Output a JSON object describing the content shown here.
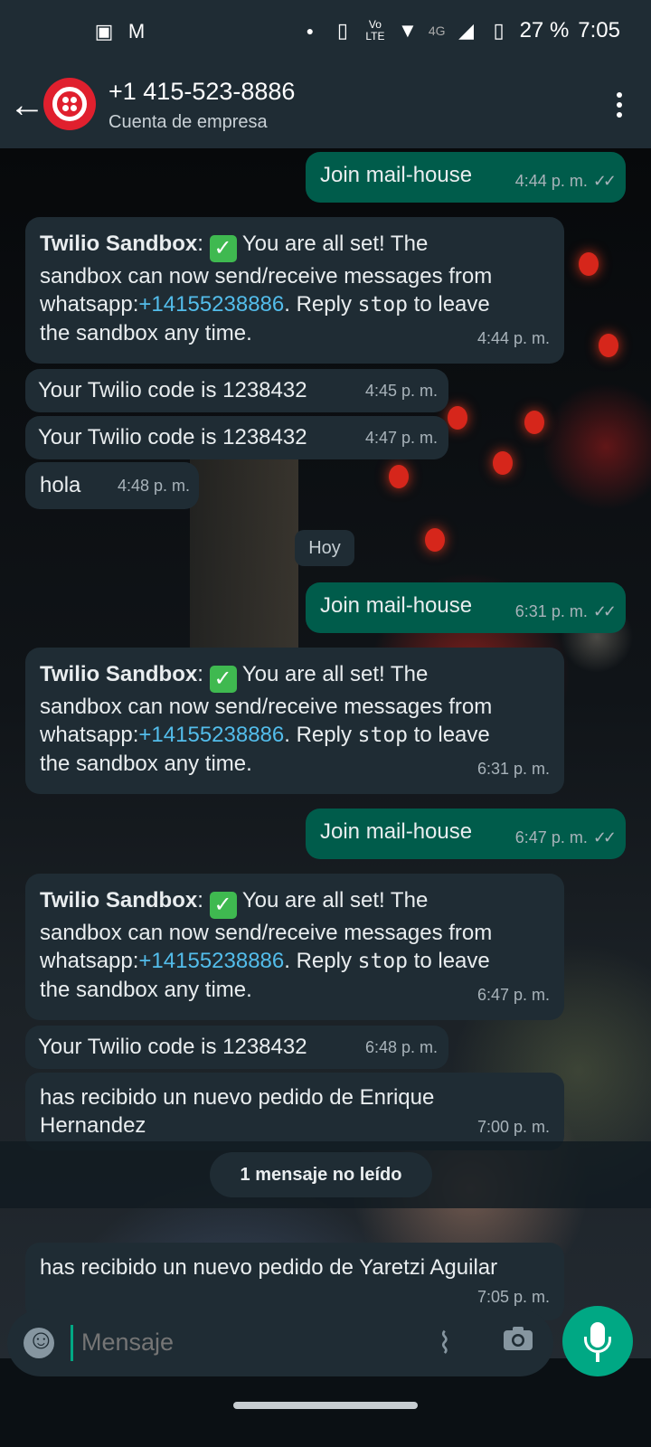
{
  "status_bar": {
    "battery": "27 %",
    "time": "7:05",
    "network": "4G"
  },
  "header": {
    "contact": "+1 415-523-8886",
    "subtitle": "Cuenta de empresa"
  },
  "messages": [
    {
      "dir": "out",
      "text": "Join mail-house",
      "time": "4:44 p. m."
    },
    {
      "dir": "in",
      "sender": "Twilio Sandbox",
      "line1": " You are all set! The",
      "line2": "sandbox can now send/receive messages from",
      "prefix": "whatsapp:",
      "number": "+14155238886",
      "mid": ". Reply ",
      "cmd": "stop",
      "suffix": " to leave",
      "line4": "the sandbox any time.",
      "time": "4:44 p. m."
    },
    {
      "dir": "in",
      "text": "Your Twilio code is 1238432",
      "time": "4:45 p. m."
    },
    {
      "dir": "in",
      "text": "Your Twilio code is 1238432",
      "time": "4:47 p. m."
    },
    {
      "dir": "in",
      "text": "hola",
      "time": "4:48 p. m."
    },
    {
      "dir": "out",
      "text": "Join mail-house",
      "time": "6:31 p. m."
    },
    {
      "dir": "in",
      "sender": "Twilio Sandbox",
      "line1": " You are all set! The",
      "line2": "sandbox can now send/receive messages from",
      "prefix": "whatsapp:",
      "number": "+14155238886",
      "mid": ". Reply ",
      "cmd": "stop",
      "suffix": " to leave",
      "line4": "the sandbox any time.",
      "time": "6:31 p. m."
    },
    {
      "dir": "out",
      "text": "Join mail-house",
      "time": "6:47 p. m."
    },
    {
      "dir": "in",
      "sender": "Twilio Sandbox",
      "line1": " You are all set! The",
      "line2": "sandbox can now send/receive messages from",
      "prefix": "whatsapp:",
      "number": "+14155238886",
      "mid": ". Reply ",
      "cmd": "stop",
      "suffix": " to leave",
      "line4": "the sandbox any time.",
      "time": "6:47 p. m."
    },
    {
      "dir": "in",
      "text": "Your Twilio code is 1238432",
      "time": "6:48 p. m."
    },
    {
      "dir": "in",
      "line1": "has recibido un nuevo pedido de Enrique",
      "line2": "Hernandez",
      "time": "7:00 p. m."
    },
    {
      "dir": "in",
      "text": "has recibido un nuevo pedido de Yaretzi Aguilar",
      "time": "7:05 p. m."
    }
  ],
  "date_divider": "Hoy",
  "unread_banner": "1 mensaje no leído",
  "composer": {
    "placeholder": "Mensaje"
  },
  "colors": {
    "incoming_bubble": "#1f2c34",
    "outgoing_bubble": "#005c4b",
    "accent": "#00a884",
    "link": "#53bdeb"
  },
  "icons": [
    "back-arrow-icon",
    "more-vert-icon",
    "emoji-icon",
    "attach-icon",
    "camera-icon",
    "mic-icon",
    "read-receipt-icon",
    "checkmark-emoji-icon"
  ]
}
